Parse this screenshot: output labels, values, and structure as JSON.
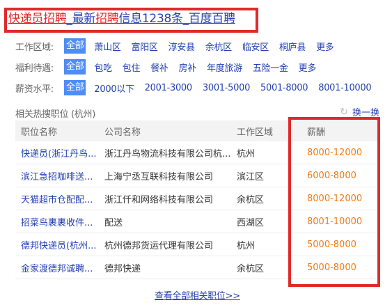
{
  "title": {
    "part1": "快递员招聘",
    "part2": "_最新",
    "part3": "招聘",
    "part4": "信息1238条_百度百聘"
  },
  "filters": [
    {
      "label": "工作区域:",
      "options": [
        "全部",
        "萧山区",
        "富阳区",
        "淳安县",
        "余杭区",
        "临安区",
        "桐庐县",
        "更多"
      ]
    },
    {
      "label": "福利待遇:",
      "options": [
        "全部",
        "包吃",
        "包住",
        "餐补",
        "房补",
        "年度旅游",
        "五险一金",
        "更多"
      ]
    },
    {
      "label": "薪资水平:",
      "options": [
        "全部",
        "2000以下",
        "2001-3000",
        "3001-5000",
        "5001-8000",
        "8001-10000"
      ]
    }
  ],
  "hot_label": "相关热搜职位 (杭州)",
  "refresh_label": "换一换",
  "table": {
    "headers": [
      "职位名称",
      "公司名称",
      "工作区域",
      "薪酬"
    ],
    "rows": [
      [
        "快递员(浙江丹鸟...",
        "浙江丹鸟物流科技有限公司杭...",
        "杭州",
        "8000-12000"
      ],
      [
        "滨江急招咖啡送...",
        "上海宁丞互联科技有限公司",
        "滨江区",
        "6000-8000"
      ],
      [
        "天猫超市仓配配...",
        "浙江仟和网络科技有限公司",
        "余杭区",
        "8000-12000"
      ],
      [
        "招菜鸟裹裹收件...",
        "配送",
        "西湖区",
        "8001-10000"
      ],
      [
        "德邦快递员(杭州...",
        "杭州德邦货运代理有限公司",
        "杭州",
        "5000-8000"
      ],
      [
        "金家渡德邦诚聘...",
        "德邦快递",
        "余杭区",
        "5000-8000"
      ]
    ]
  },
  "more_link": "查看全部相关职位>>",
  "colors": {
    "link": "#2440b3",
    "highlight": "#e0292a",
    "salary": "#ef7b1a",
    "selected_bg": "#4e8cf6",
    "annotation_box": "#e02a2a"
  }
}
